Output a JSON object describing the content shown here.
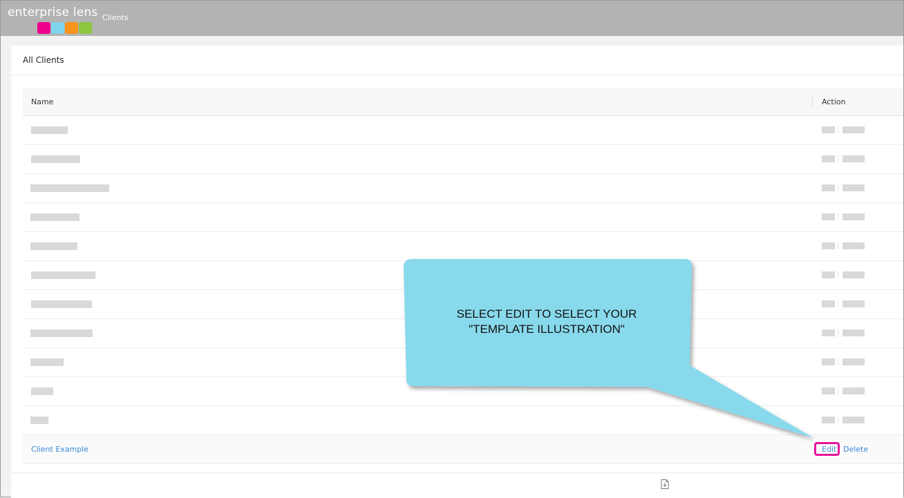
{
  "header": {
    "logo_text": "enterprise lens",
    "logo_colors": [
      "#ec008c",
      "#7fd3ec",
      "#f7941d",
      "#8dc63f"
    ],
    "nav_item": "Clients",
    "background": "#b3b3b3"
  },
  "card": {
    "title": "All Clients"
  },
  "table": {
    "columns": [
      "Name",
      "Action"
    ],
    "placeholder_rows": [
      {
        "redacted": true
      },
      {
        "redacted": true
      },
      {
        "redacted": true
      },
      {
        "redacted": true
      },
      {
        "redacted": true
      },
      {
        "redacted": true
      },
      {
        "redacted": true
      },
      {
        "redacted": true
      },
      {
        "redacted": true
      },
      {
        "redacted": true
      },
      {
        "redacted": true
      }
    ],
    "example_row": {
      "name": "Client Example",
      "edit_label": "Edit",
      "delete_label": "Delete"
    }
  },
  "callout": {
    "text": "SELECT EDIT TO SELECT YOUR\n\"TEMPLATE ILLUSTRATION\"",
    "fill": "#89d9ec",
    "highlight_color": "#e6149b"
  },
  "footer": {
    "icon": "document-icon"
  }
}
